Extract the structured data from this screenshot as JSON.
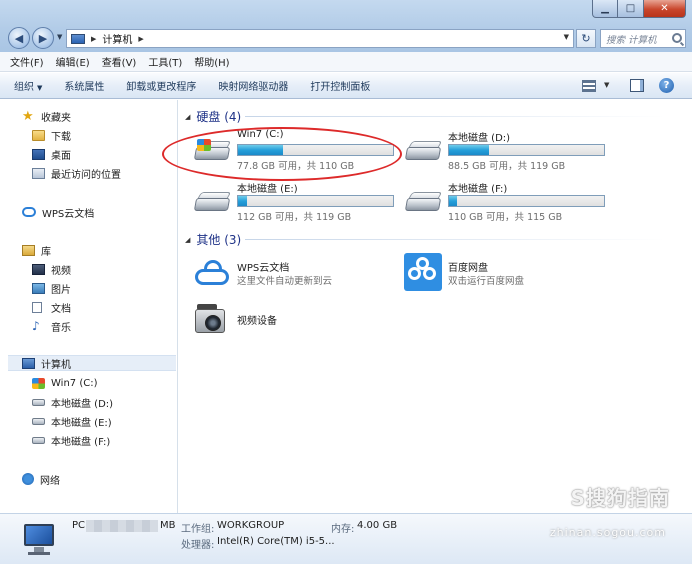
{
  "window": {
    "minimize": "▁",
    "maximize": "□",
    "close": "✕"
  },
  "address": {
    "location": "计算机",
    "refresh": "↻",
    "search_placeholder": "搜索 计算机"
  },
  "menu": [
    "文件(F)",
    "编辑(E)",
    "查看(V)",
    "工具(T)",
    "帮助(H)"
  ],
  "commands": [
    "组织",
    "系统属性",
    "卸载或更改程序",
    "映射网络驱动器",
    "打开控制面板"
  ],
  "sidebar": {
    "favorites": "收藏夹",
    "fav_items": [
      "下载",
      "桌面",
      "最近访问的位置"
    ],
    "wps": "WPS云文档",
    "library": "库",
    "lib_items": [
      "视频",
      "图片",
      "文档",
      "音乐"
    ],
    "computer": "计算机",
    "comp_items": [
      "Win7 (C:)",
      "本地磁盘 (D:)",
      "本地磁盘 (E:)",
      "本地磁盘 (F:)"
    ],
    "network": "网络"
  },
  "groups": {
    "drives": "硬盘 (4)",
    "others": "其他 (3)"
  },
  "drives": [
    {
      "name": "Win7 (C:)",
      "info": "77.8 GB 可用，共 110 GB",
      "used": 0.29
    },
    {
      "name": "本地磁盘 (D:)",
      "info": "88.5 GB 可用，共 119 GB",
      "used": 0.26
    },
    {
      "name": "本地磁盘 (E:)",
      "info": "112 GB 可用，共 119 GB",
      "used": 0.06
    },
    {
      "name": "本地磁盘 (F:)",
      "info": "110 GB 可用，共 115 GB",
      "used": 0.05
    }
  ],
  "others": [
    {
      "name": "WPS云文档",
      "desc": "这里文件自动更新到云"
    },
    {
      "name": "百度网盘",
      "desc": "双击运行百度网盘"
    },
    {
      "name": "视频设备",
      "desc": ""
    }
  ],
  "details": {
    "name_prefix": "PC",
    "name_suffix": "MB",
    "workgroup_label": "工作组:",
    "workgroup": "WORKGROUP",
    "memory_label": "内存:",
    "memory": "4.00 GB",
    "cpu_label": "处理器:",
    "cpu": "Intel(R) Core(TM) i5-5..."
  },
  "watermark": {
    "main": "S搜狗指南",
    "sub": "zhinan.sogou.com"
  },
  "colors": {
    "accent": "#1e3287",
    "bar_fill": "#26a0da",
    "annotation": "#dd2a2a"
  }
}
